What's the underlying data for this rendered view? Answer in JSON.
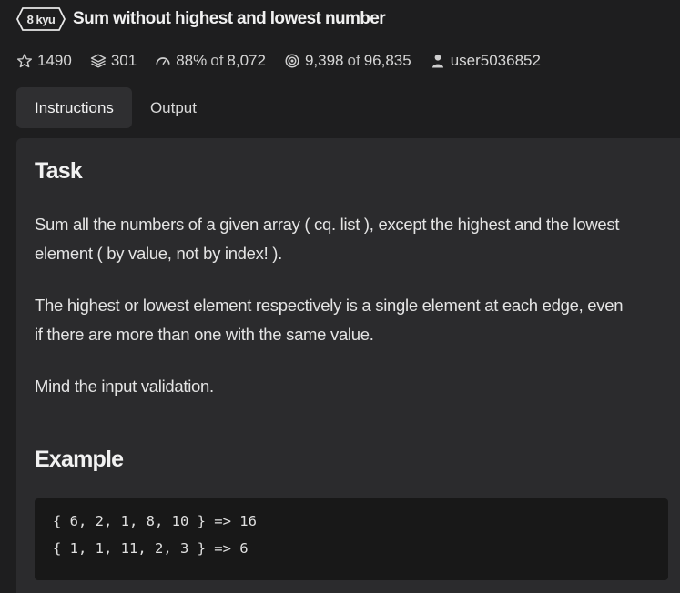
{
  "kata": {
    "rank": "8 kyu",
    "title": "Sum without highest and lowest number"
  },
  "stats": {
    "stars": "1490",
    "collections": "301",
    "satisfaction_pct": "88%",
    "satisfaction_of": "of",
    "satisfaction_total": "8,072",
    "completed": "9,398",
    "completed_of": "of",
    "completed_total": "96,835",
    "author": "user5036852"
  },
  "tabs": [
    {
      "label": "Instructions",
      "active": true
    },
    {
      "label": "Output",
      "active": false
    }
  ],
  "description": {
    "task_heading": "Task",
    "para1_line1": "Sum all the numbers of a given array ( cq. list ), except the highest and the lowest",
    "para1_line2": "element ( by value, not by index! ).",
    "para2_line1": "The highest or lowest element respectively is a single element at each edge, even",
    "para2_line2": "if there are more than one with the same value.",
    "para3": "Mind the input validation.",
    "example_heading": "Example",
    "code_lines": [
      "{ 6, 2, 1, 8, 10 } => 16",
      "{ 1, 1, 11, 2, 3 } => 6"
    ]
  },
  "icons": {
    "star": "star-icon",
    "collections": "layers-icon",
    "satisfaction": "gauge-icon",
    "completed": "target-icon",
    "author": "user-icon"
  }
}
